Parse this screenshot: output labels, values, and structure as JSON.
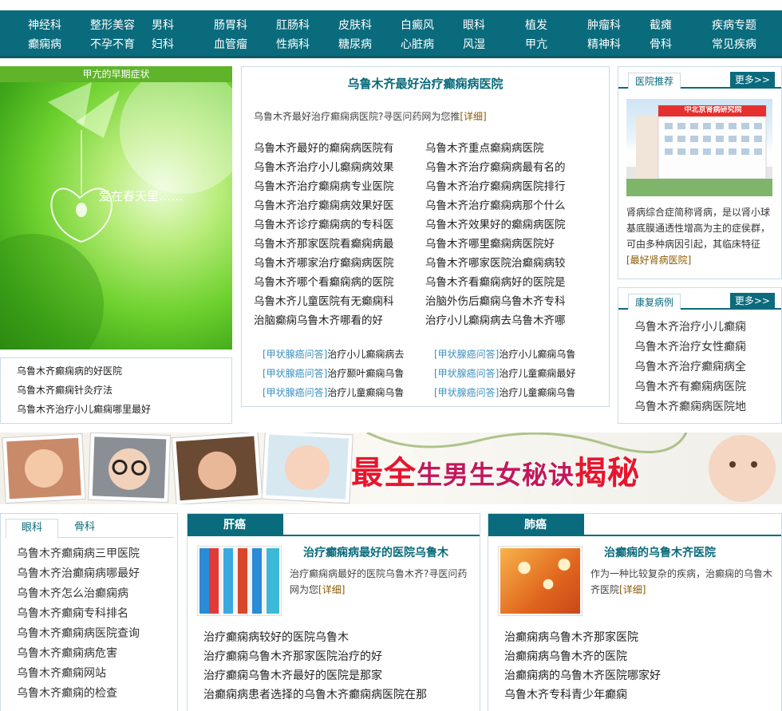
{
  "nav": {
    "row1": [
      "神经科",
      "整形美容",
      "男科",
      "肠胃科",
      "肛肠科",
      "皮肤科",
      "白癜风",
      "眼科",
      "植发",
      "肿瘤科",
      "截瘫",
      "疾病专题"
    ],
    "row2": [
      "癫痫病",
      "不孕不育",
      "妇科",
      "血管瘤",
      "性病科",
      "糖尿病",
      "心脏病",
      "风湿",
      "甲亢",
      "精神科",
      "骨科",
      "常见疾病"
    ]
  },
  "promo": {
    "header": "甲亢的早期症状",
    "image_caption": "爱在春天里……",
    "links": [
      "乌鲁木齐癫痫病的好医院",
      "乌鲁木齐癫痫针灸疗法",
      "乌鲁木齐治疗小儿癫痫哪里最好"
    ]
  },
  "center": {
    "title": "乌鲁木齐最好治疗癫痫病医院",
    "intro": "乌鲁木齐最好治疗癫痫病医院?寻医问药网为您推",
    "detail_label": "[详细]",
    "left_links": [
      "乌鲁木齐最好的癫痫病医院有",
      "乌鲁木齐治疗小儿癫痫病效果",
      "乌鲁木齐治疗癫痫病专业医院",
      "乌鲁木齐治疗癫痫病效果好医",
      "乌鲁木齐诊疗癫痫病的专科医",
      "乌鲁木齐那家医院看癫痫病最",
      "乌鲁木齐哪家治疗癫痫病医院",
      "乌鲁木齐哪个看癫痫病的医院",
      "乌鲁木齐儿童医院有无癫痫科",
      "治脑癫痫乌鲁木齐哪看的好"
    ],
    "right_links": [
      "乌鲁木齐重点癫痫病医院",
      "乌鲁木齐治疗癫痫病最有名的",
      "乌鲁木齐治疗癫痫病医院排行",
      "乌鲁木齐治疗癫痫病那个什么",
      "乌鲁木齐效果好的癫痫病医院",
      "乌鲁木齐哪里癫痫病医院好",
      "乌鲁木齐哪家医院治癫痫病较",
      "乌鲁木齐看癫痫病好的医院是",
      "治脑外伤后癫痫乌鲁木齐专科",
      "治疗小儿癫痫病去乌鲁木齐哪"
    ],
    "tag_label": "[甲状腺癌问答]",
    "tag_left": [
      "治疗小儿癫痫病去",
      "治疗颞叶癫痫乌鲁",
      "治疗儿童癫痫乌鲁"
    ],
    "tag_right": [
      "治疗小儿癫痫乌鲁",
      "治疗儿童癫痫最好",
      "治疗儿童癫痫乌鲁"
    ]
  },
  "right": {
    "hospital": {
      "tab": "医院推荐",
      "more": "更多>>",
      "sign": "中北京肾病研究院",
      "text": "肾病综合症简称肾病，是以肾小球基底膜通透性增高为主的症侯群，可由多种病因引起，其临床特征",
      "link": "[最好肾病医院]"
    },
    "recovery": {
      "tab": "康复病例",
      "more": "更多>>",
      "links": [
        "乌鲁木齐治疗小儿癫痫",
        "乌鲁木齐治疗女性癫痫",
        "乌鲁木齐治疗癫痫病全",
        "乌鲁木齐有癫痫病医院",
        "乌鲁木齐癫痫病医院地"
      ]
    }
  },
  "banner": {
    "text_a": "最全",
    "text_b": "生男生女秘诀",
    "text_c": "揭秘"
  },
  "bottom": {
    "tabs_box": {
      "tabs": [
        "眼科",
        "骨科"
      ],
      "links": [
        "乌鲁木齐癫痫病三甲医院",
        "乌鲁木齐治癫痫病哪最好",
        "乌鲁木齐怎么治癫痫病",
        "乌鲁木齐癫痫专科排名",
        "乌鲁木齐癫痫病医院查询",
        "乌鲁木齐癫痫病危害",
        "乌鲁木齐癫痫网站",
        "乌鲁木齐癫痫的检查"
      ]
    },
    "liver": {
      "tab": "肝癌",
      "title": "治疗癫痫病最好的医院乌鲁木",
      "intro": "治疗癫痫病最好的医院乌鲁木齐?寻医问药网为您",
      "detail": "[详细]",
      "links": [
        "治疗癫痫病较好的医院乌鲁木",
        "治疗癫痫乌鲁木齐那家医院治疗的好",
        "治疗癫痫乌鲁木齐最好的医院是那家",
        "治癫痫病患者选择的乌鲁木齐癫痫病医院在那"
      ]
    },
    "lung": {
      "tab": "肺癌",
      "title": "治癫痫的乌鲁木齐医院",
      "intro": "作为一种比较复杂的疾病，治癫痫的乌鲁木齐医院",
      "detail": "[详细]",
      "links": [
        "治癫痫病乌鲁木齐那家医院",
        "治癫痫病乌鲁木齐的医院",
        "治癫痫病的乌鲁木齐医院哪家好",
        "乌鲁木齐专科青少年癫痫"
      ]
    }
  },
  "colors": {
    "teal": "#0a6b7c",
    "green": "#5fb42a",
    "red": "#e8152d",
    "border": "#c9dce4"
  }
}
